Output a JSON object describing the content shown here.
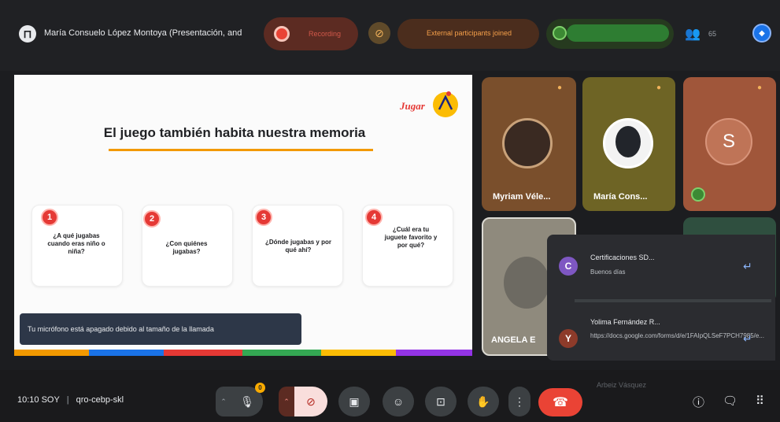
{
  "header": {
    "presenter_name": "María Consuelo López Montoya (Presentación, and",
    "recording_label": "Recording",
    "notification": "External participants joined",
    "participant_count": "65"
  },
  "slide": {
    "logo_text": "Jugar",
    "title": "El juego también habita nuestra memoria",
    "cards": [
      {
        "number": "1",
        "question": "¿A qué jugabas cuando eras niño o niña?"
      },
      {
        "number": "2",
        "question": "¿Con quiénes jugabas?"
      },
      {
        "number": "3",
        "question": "¿Dónde jugabas y por qué ahí?"
      },
      {
        "number": "4",
        "question": "¿Cuál era tu juguete favorito y por qué?"
      }
    ],
    "strip_colors": [
      "#f29900",
      "#1a73e8",
      "#e53935",
      "#34a853",
      "#fbbc04",
      "#9334e6"
    ]
  },
  "toast": {
    "text": "Tu micrófono está apagado debido al tamaño de la llamada"
  },
  "participants": [
    {
      "name": "Myriam Véle...",
      "avatar_color": "#3a2a22"
    },
    {
      "name": "María Cons...",
      "avatar_color": "#22252b"
    },
    {
      "name": "S",
      "avatar_color": "#a0563a"
    },
    {
      "name": "ANGELA E",
      "avatar_color": "#6d6a62"
    }
  ],
  "chat": {
    "messages": [
      {
        "avatar_letter": "C",
        "avatar_color": "#7e57c2",
        "sender": "Certificaciones SD...",
        "text": "Buenos días"
      },
      {
        "avatar_letter": "Y",
        "avatar_color": "#8d3b2a",
        "sender": "Yolima Fernández R...",
        "text": "https://docs.google.com/forms/d/e/1FAIpQLSeF7PCH7985/e..."
      }
    ],
    "faded_sender": "Arbeiz Vásquez"
  },
  "footer": {
    "time": "10:10 SOY",
    "separator": "|",
    "meeting_code": "qro-cebp-skl",
    "mic_badge": "0"
  }
}
